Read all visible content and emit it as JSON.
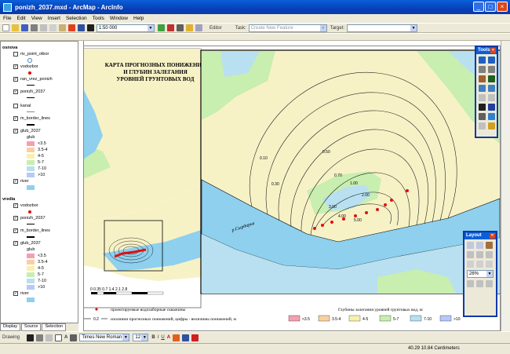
{
  "window": {
    "title": "ponizh_2037.mxd - ArcMap - ArcInfo"
  },
  "menu": [
    "File",
    "Edit",
    "View",
    "Insert",
    "Selection",
    "Tools",
    "Window",
    "Help"
  ],
  "toolbar": {
    "scale": "1:50 000",
    "editor": "Editor",
    "task_label": "Task:",
    "task_value": "Create New Feature",
    "target_label": "Target:"
  },
  "toc": {
    "groups": [
      {
        "name": "osnova",
        "layers": [
          {
            "name": "riv_point_otbor",
            "checked": false,
            "symbol": "circle"
          },
          {
            "name": "vodozbor",
            "checked": true,
            "symbol": "red-dot"
          },
          {
            "name": "ran_vrez_ponizh",
            "checked": true,
            "symbol": "line"
          },
          {
            "name": "ponizh_2037",
            "checked": true,
            "symbol": "line"
          },
          {
            "name": "kanal",
            "checked": false,
            "symbol": "line"
          },
          {
            "name": "m_border_lines",
            "checked": true,
            "symbol": "line"
          },
          {
            "name": "glub_2037",
            "checked": true,
            "symbol": "none"
          }
        ]
      },
      {
        "name": "vredia",
        "layers": [
          {
            "name": "vodozbor",
            "checked": true,
            "symbol": "red-dot"
          },
          {
            "name": "ponizh_2037",
            "checked": true,
            "symbol": "line"
          },
          {
            "name": "m_border_lines",
            "checked": true,
            "symbol": "line"
          },
          {
            "name": "glub_2037",
            "checked": true,
            "symbol": "none"
          },
          {
            "name": "river",
            "checked": true,
            "symbol": "blue"
          }
        ]
      }
    ],
    "glub_field": "glub",
    "classes": [
      {
        "label": "<3.5",
        "color": "#f4a0b0"
      },
      {
        "label": "3.5-4",
        "color": "#f8d0a0"
      },
      {
        "label": "4-5",
        "color": "#f8f0b0"
      },
      {
        "label": "5-7",
        "color": "#c8eeb0"
      },
      {
        "label": "7-10",
        "color": "#b8e0f0"
      },
      {
        "label": ">10",
        "color": "#b8c8f8"
      }
    ],
    "river_layer": "river",
    "tabs": [
      "Display",
      "Source",
      "Selection"
    ]
  },
  "map": {
    "title_lines": [
      "КАРТА ПРОГНОЗНЫХ ПОНИЖЕНИЙ",
      "И ГЛУБИН ЗАЛЕГАНИЯ",
      "УРОВНЕЙ ГРУНТОВЫХ ВОД"
    ],
    "river_label": "р.Сырдарья",
    "contour_labels": [
      "0.10",
      "0.30",
      "0.50",
      "0.70",
      "1.00",
      "2.00",
      "3.00",
      "4.00",
      "5.00"
    ],
    "scalebar": "0 0.35 0.7    1.4    2.1    2.8"
  },
  "legend": {
    "wells": "проектируемые водозаборные скважины",
    "isolines": "изолинии прогнозных понижений, цифры - величины понижений, м",
    "isoline_value": "0.2",
    "depth_title": "Глубины залегания уровней грунтовых вод, м:",
    "classes": [
      "<3.5",
      "3.5-4",
      "4-5",
      "5-7",
      "7-10",
      ">10"
    ]
  },
  "tools_palette": {
    "title": "Tools"
  },
  "layout_palette": {
    "title": "Layout",
    "zoom": "26%"
  },
  "drawing": {
    "label": "Drawing",
    "font": "Times New Roman",
    "size": "12"
  },
  "status": {
    "coords": "40.29  10.84 Centimeters"
  }
}
